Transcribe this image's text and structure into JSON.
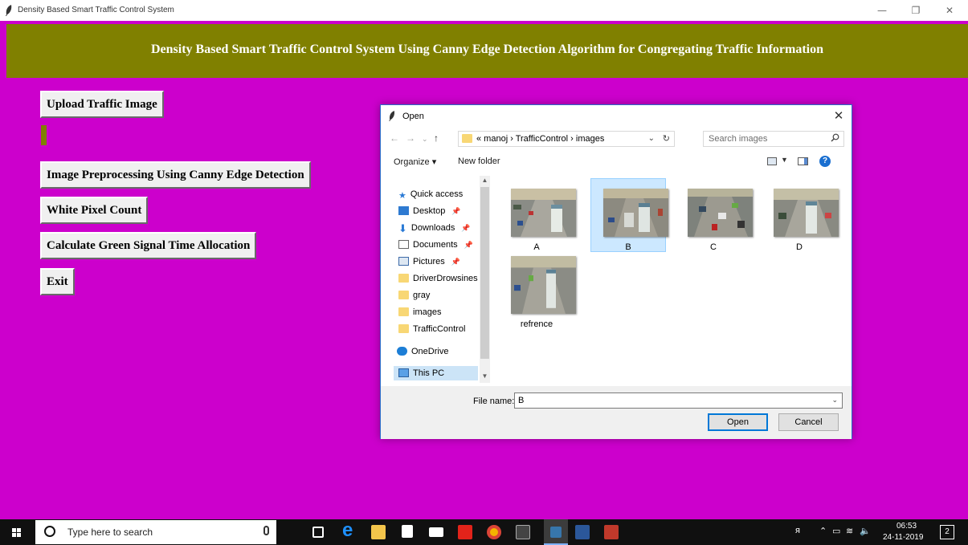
{
  "window": {
    "title": "Density Based Smart Traffic Control System",
    "minimize_glyph": "—",
    "restore_glyph": "❐",
    "close_glyph": "✕"
  },
  "header": {
    "text": "Density Based Smart Traffic Control System Using Canny Edge Detection Algorithm for Congregating Traffic Information",
    "color": "#808000",
    "background": "#cc00cc"
  },
  "buttons": {
    "upload": "Upload Traffic Image",
    "preprocess": "Image Preprocessing Using Canny Edge Detection",
    "white_pixel": "White Pixel Count",
    "green_signal": "Calculate Green Signal Time Allocation",
    "exit": "Exit"
  },
  "dialog": {
    "title": "Open",
    "close_glyph": "✕",
    "breadcrumb": "« manoj › TrafficControl › images",
    "search_placeholder": "Search images",
    "organize": "Organize ▾",
    "new_folder": "New folder",
    "nav_items": [
      {
        "label": "Quick access",
        "icon": "star-icon"
      },
      {
        "label": "Desktop",
        "icon": "desktop-icon"
      },
      {
        "label": "Downloads",
        "icon": "download-icon"
      },
      {
        "label": "Documents",
        "icon": "documents-icon"
      },
      {
        "label": "Pictures",
        "icon": "pictures-icon"
      },
      {
        "label": "DriverDrowsines",
        "icon": "folder-icon"
      },
      {
        "label": "gray",
        "icon": "folder-icon"
      },
      {
        "label": "images",
        "icon": "folder-icon"
      },
      {
        "label": "TrafficControl",
        "icon": "folder-icon"
      },
      {
        "label": "OneDrive",
        "icon": "onedrive-icon"
      },
      {
        "label": "This PC",
        "icon": "pc-icon"
      }
    ],
    "files": [
      {
        "label": "A",
        "selected": false
      },
      {
        "label": "B",
        "selected": true
      },
      {
        "label": "C",
        "selected": false
      },
      {
        "label": "D",
        "selected": false
      },
      {
        "label": "refrence",
        "selected": false
      }
    ],
    "file_name_label": "File name:",
    "file_name_value": "B",
    "open_button": "Open",
    "cancel_button": "Cancel"
  },
  "taskbar": {
    "search_placeholder": "Type here to search",
    "time": "06:53",
    "date": "24-11-2019",
    "notification_count": "2"
  }
}
